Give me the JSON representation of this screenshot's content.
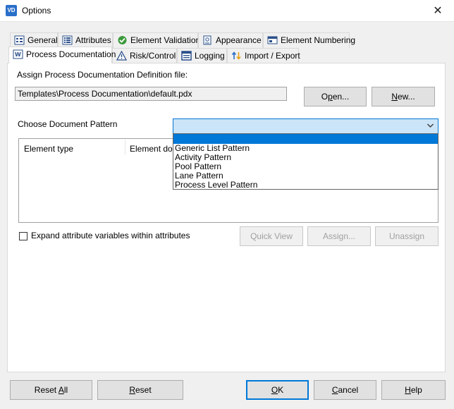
{
  "window": {
    "title": "Options",
    "app_icon_text": "VD",
    "close_glyph": "✕"
  },
  "tabs": {
    "row1": [
      {
        "label": "General",
        "icon": "general-icon"
      },
      {
        "label": "Attributes",
        "icon": "attributes-icon"
      },
      {
        "label": "Element Validation",
        "icon": "checkmark-icon"
      },
      {
        "label": "Appearance",
        "icon": "appearance-icon"
      },
      {
        "label": "Element Numbering",
        "icon": "numbering-icon"
      }
    ],
    "row2": [
      {
        "label": "Process Documentation",
        "icon": "document-icon",
        "active": true
      },
      {
        "label": "Risk/Control",
        "icon": "risk-icon"
      },
      {
        "label": "Logging",
        "icon": "logging-icon"
      },
      {
        "label": "Import / Export",
        "icon": "import-export-icon"
      }
    ]
  },
  "panel": {
    "assign_label": "Assign Process Documentation Definition file:",
    "definition_path": "Templates\\Process Documentation\\default.pdx",
    "open_button": {
      "prefix": "O",
      "accel": "p",
      "rest": "en..."
    },
    "new_button": {
      "accel": "N",
      "rest": "ew..."
    },
    "pattern_label": "Choose Document Pattern",
    "pattern_value": "",
    "pattern_options": [
      "Generic List Pattern",
      "Activity Pattern",
      "Pool Pattern",
      "Lane Pattern",
      "Process Level Pattern"
    ],
    "list_columns": [
      "Element type",
      "Element docu"
    ],
    "expand_checkbox_label": "Expand attribute variables within attributes",
    "expand_checked": false,
    "quick_view_button": "Quick View",
    "assign_button": "Assign...",
    "unassign_button": "Unassign"
  },
  "footer": {
    "reset_all": {
      "prefix": "Reset ",
      "accel": "A",
      "rest": "ll"
    },
    "reset": {
      "accel": "R",
      "rest": "eset"
    },
    "ok": {
      "accel": "O",
      "rest": "K"
    },
    "cancel": {
      "accel": "C",
      "rest": "ancel"
    },
    "help": {
      "accel": "H",
      "rest": "elp"
    }
  },
  "colors": {
    "accent": "#0078d7",
    "combo_highlight": "#cce4f7",
    "dialog_bg": "#f0f0f0"
  }
}
